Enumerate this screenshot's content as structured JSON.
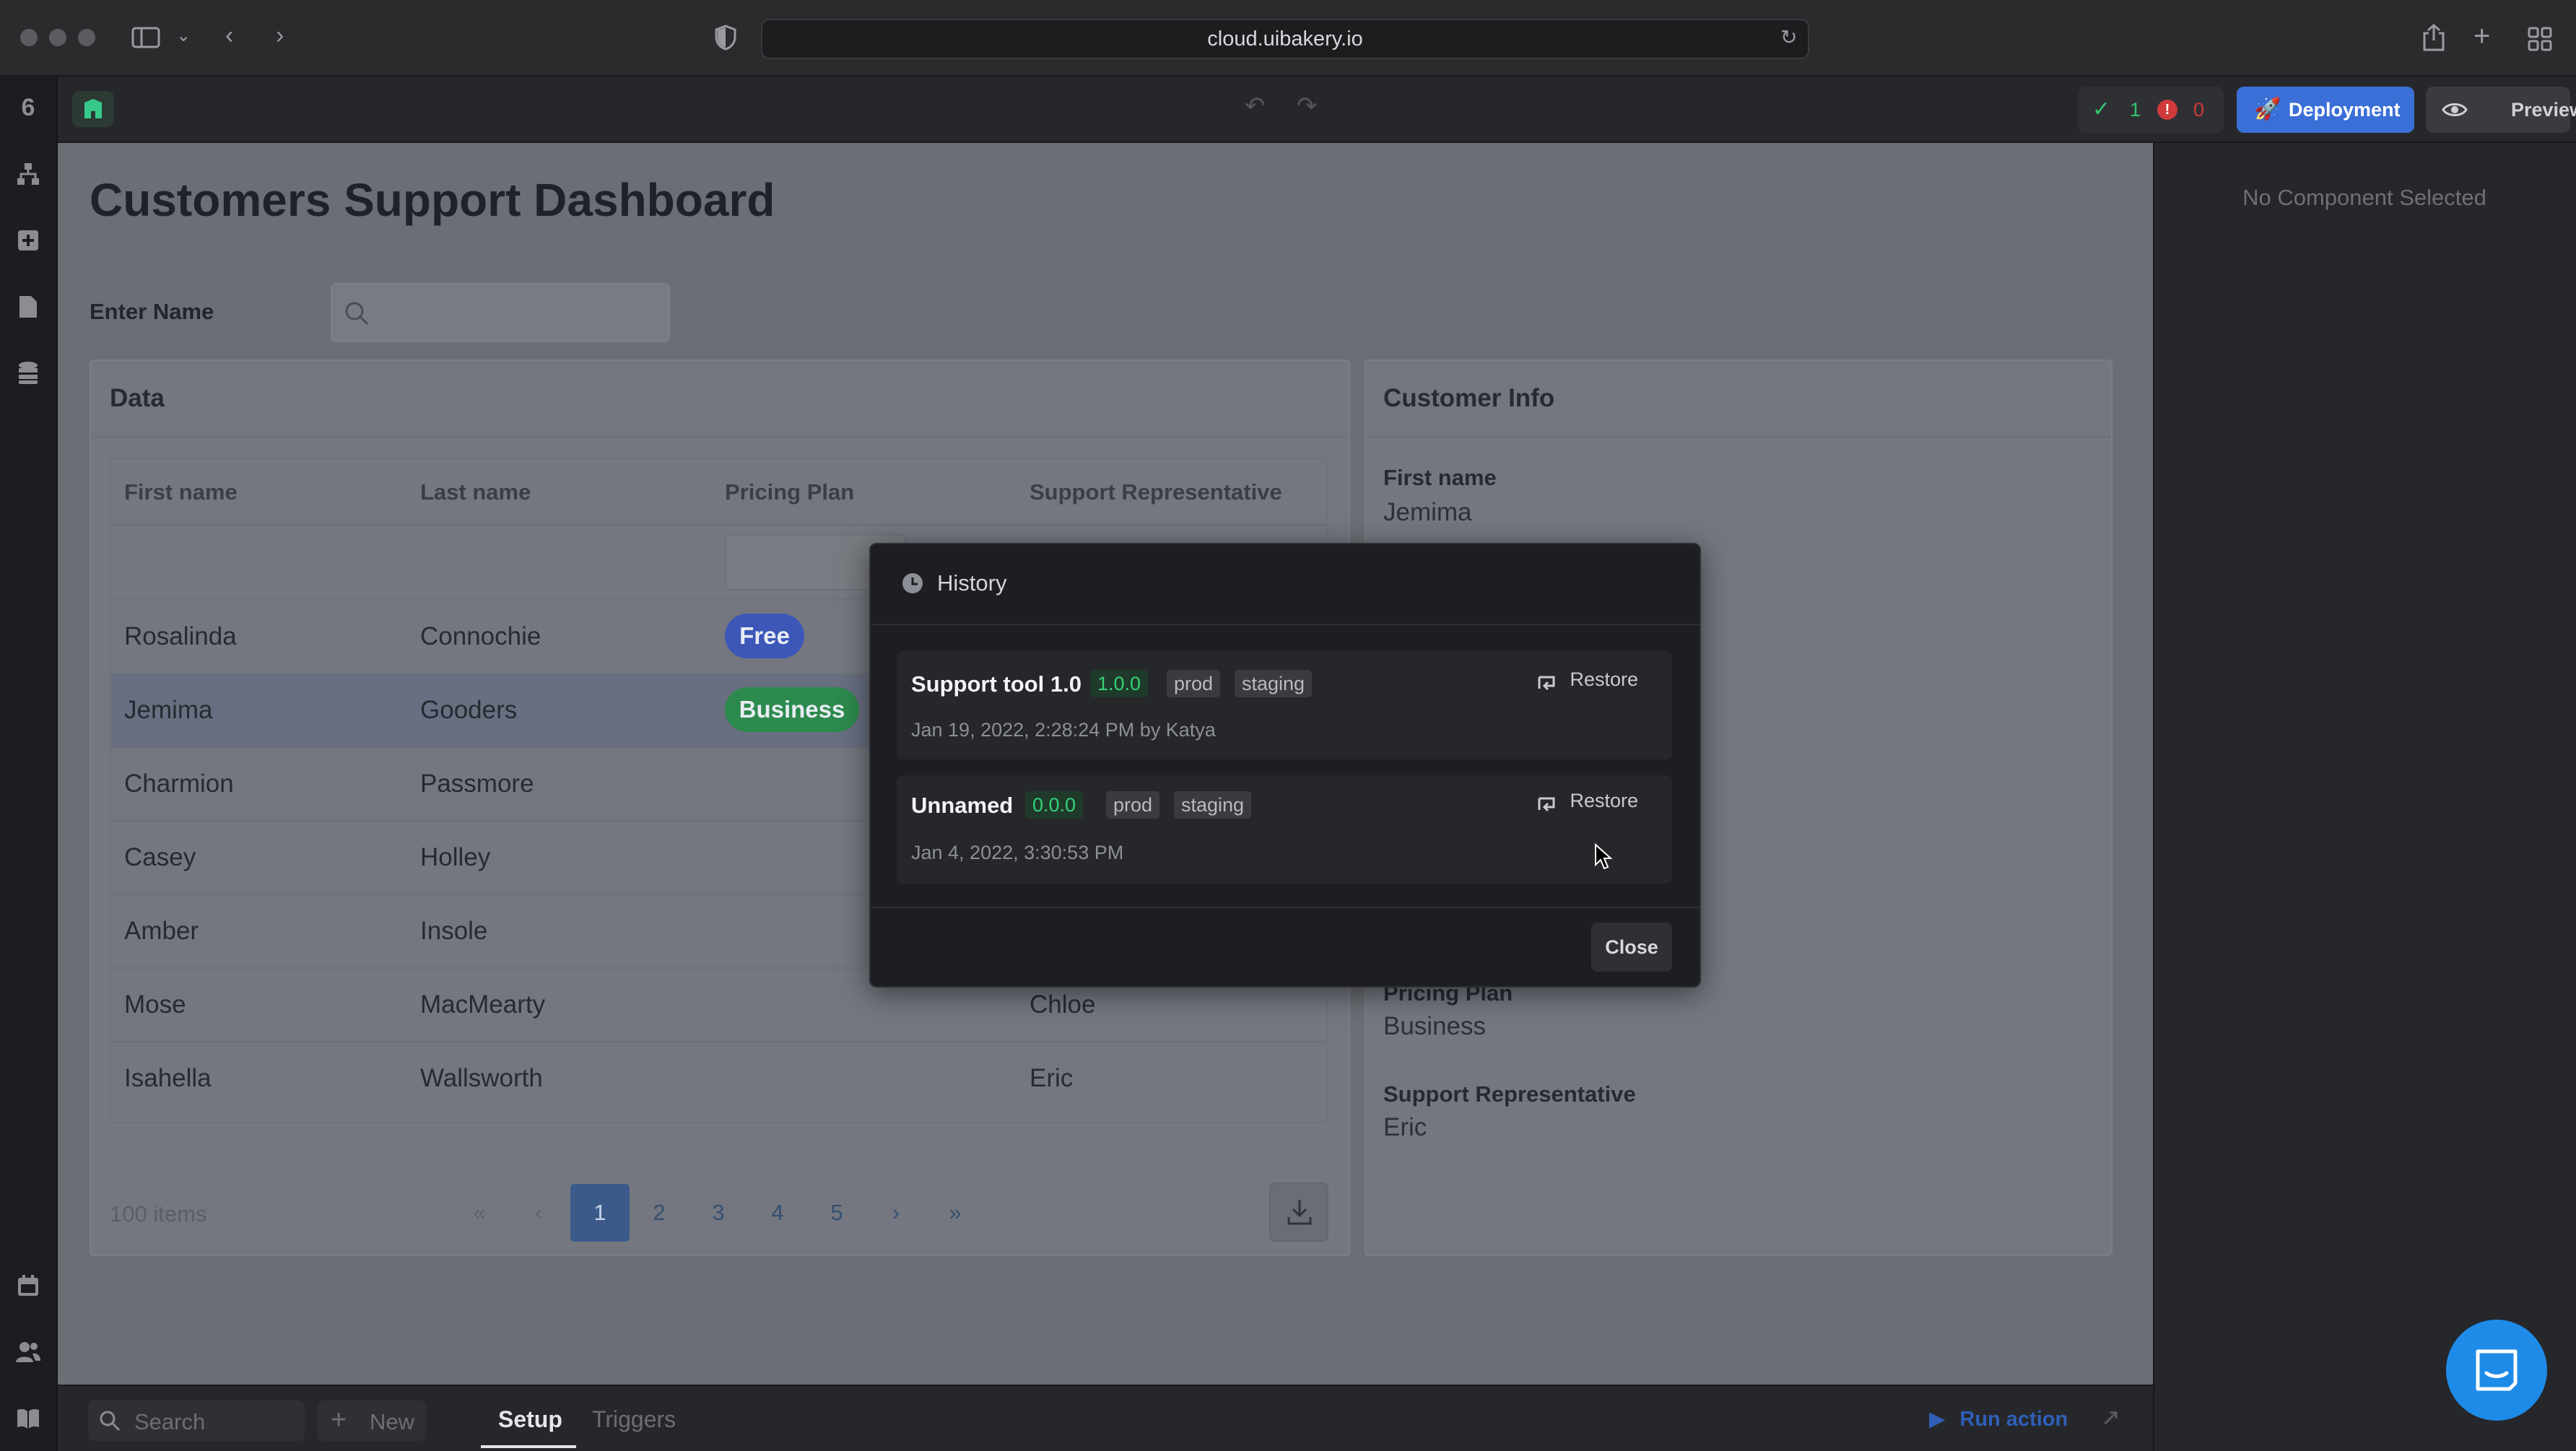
{
  "browser": {
    "url": "cloud.uibakery.io"
  },
  "toolbar": {
    "status_ok_count": "1",
    "status_error_count": "0",
    "deployment_label": "Deployment",
    "preview_label": "Preview"
  },
  "page": {
    "title": "Customers Support Dashboard",
    "search_label": "Enter Name",
    "search_placeholder": ""
  },
  "data_card": {
    "title": "Data",
    "columns": [
      "First name",
      "Last name",
      "Pricing Plan",
      "Support Representative"
    ],
    "rows": [
      {
        "first": "Rosalinda",
        "last": "Connochie",
        "plan": "Free",
        "rep": ""
      },
      {
        "first": "Jemima",
        "last": "Gooders",
        "plan": "Business",
        "rep": ""
      },
      {
        "first": "Charmion",
        "last": "Passmore",
        "plan": "",
        "rep": ""
      },
      {
        "first": "Casey",
        "last": "Holley",
        "plan": "",
        "rep": ""
      },
      {
        "first": "Amber",
        "last": "Insole",
        "plan": "",
        "rep": ""
      },
      {
        "first": "Mose",
        "last": "MacMearty",
        "plan": "",
        "rep": "Chloe"
      },
      {
        "first": "Isahella",
        "last": "Wallsworth",
        "plan": "",
        "rep": "Eric"
      }
    ],
    "items_count": "100 items",
    "pager": {
      "first": "«",
      "prev": "‹",
      "pages": [
        "1",
        "2",
        "3",
        "4",
        "5"
      ],
      "next": "›",
      "last": "»",
      "current": "1"
    }
  },
  "info_card": {
    "title": "Customer Info",
    "first_name_label": "First name",
    "first_name_value": "Jemima",
    "plan_label": "Pricing Plan",
    "plan_value": "Business",
    "rep_label": "Support Representative",
    "rep_value": "Eric"
  },
  "right_panel": {
    "empty_text": "No Component Selected"
  },
  "bottom_bar": {
    "search_placeholder": "Search",
    "new_label": "New",
    "tabs": [
      "Setup",
      "Triggers"
    ],
    "active_tab": "Setup",
    "run_action_label": "Run action"
  },
  "modal": {
    "title": "History",
    "items": [
      {
        "name": "Support tool 1.0",
        "version": "1.0.0",
        "tags": [
          "prod",
          "staging"
        ],
        "date": "Jan 19, 2022, 2:28:24 PM by Katya",
        "restore": "Restore"
      },
      {
        "name": "Unnamed",
        "version": "0.0.0",
        "tags": [
          "prod",
          "staging"
        ],
        "date": "Jan 4, 2022, 3:30:53 PM",
        "restore": "Restore"
      }
    ],
    "close_label": "Close"
  },
  "colors": {
    "accent_blue": "#3b6fd8",
    "badge_free": "#3d57b8",
    "badge_business": "#2c8a4c",
    "version_green": "#34d17a",
    "chat_blue": "#1e8be8"
  }
}
